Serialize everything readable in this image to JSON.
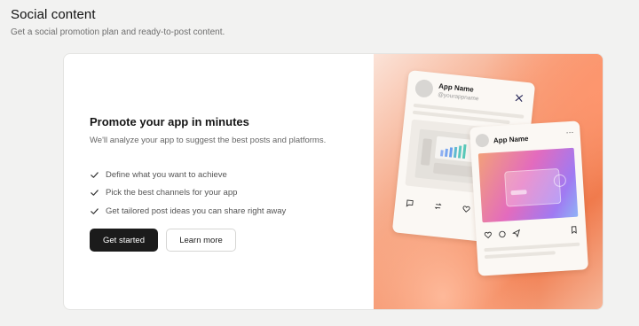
{
  "page": {
    "title": "Social content",
    "subtitle": "Get a social promotion plan and ready-to-post content."
  },
  "promo": {
    "heading": "Promote your app in minutes",
    "description": "We'll analyze your app to suggest the best posts and platforms.",
    "checklist": [
      "Define what you want to achieve",
      "Pick the best channels for your app",
      "Get tailored post ideas you can share right away"
    ],
    "primary_button": "Get started",
    "secondary_button": "Learn more"
  },
  "illustration": {
    "x_post": {
      "app_name": "App Name",
      "handle": "@yourappname",
      "platform_icon": "x-logo-icon"
    },
    "ig_post": {
      "app_name": "App Name",
      "more": "···"
    }
  },
  "colors": {
    "primary_button_bg": "#1b1b1b",
    "accent_gradient": [
      "#fbe3d8",
      "#f6a27e",
      "#f07a4c"
    ]
  }
}
